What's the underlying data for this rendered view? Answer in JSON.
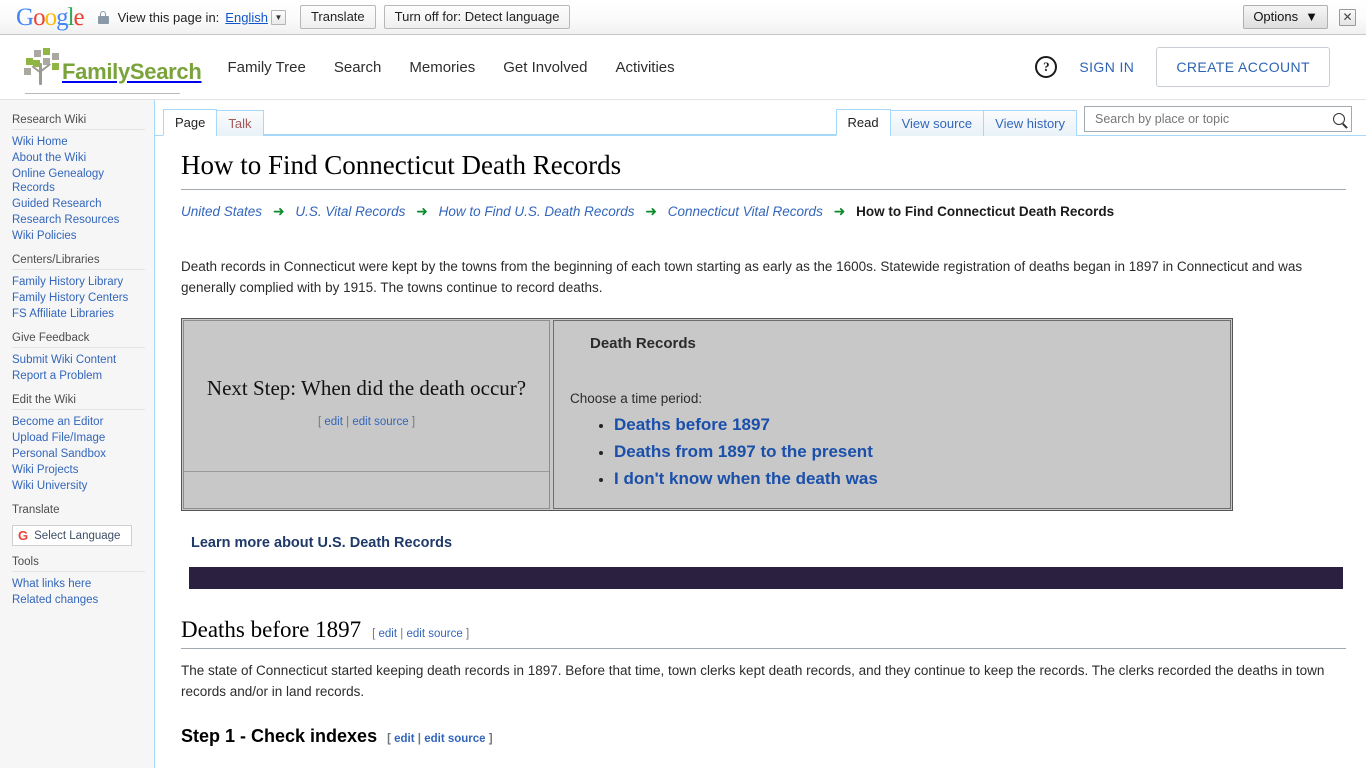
{
  "translate_bar": {
    "logo_letters": [
      "G",
      "o",
      "o",
      "g",
      "l",
      "e"
    ],
    "view_label": "View this page in:",
    "language": "English",
    "translate_button": "Translate",
    "turnoff_button": "Turn off for: Detect language",
    "options_button": "Options",
    "options_caret": "▼",
    "close_glyph": "✕"
  },
  "header": {
    "brand": "FamilySearch",
    "nav": [
      {
        "label": "Family Tree"
      },
      {
        "label": "Search"
      },
      {
        "label": "Memories"
      },
      {
        "label": "Get Involved"
      },
      {
        "label": "Activities"
      }
    ],
    "help_glyph": "?",
    "sign_in": "SIGN IN",
    "create_account": "CREATE ACCOUNT"
  },
  "sidebar": {
    "groups": [
      {
        "title": "Research Wiki",
        "items": [
          {
            "label": "Wiki Home"
          },
          {
            "label": "About the Wiki"
          },
          {
            "label": "Online Genealogy Records"
          },
          {
            "label": "Guided Research"
          },
          {
            "label": "Research Resources"
          },
          {
            "label": "Wiki Policies"
          }
        ]
      },
      {
        "title": "Centers/Libraries",
        "items": [
          {
            "label": "Family History Library"
          },
          {
            "label": "Family History Centers"
          },
          {
            "label": "FS Affiliate Libraries"
          }
        ]
      },
      {
        "title": "Give Feedback",
        "items": [
          {
            "label": "Submit Wiki Content"
          },
          {
            "label": "Report a Problem"
          }
        ]
      },
      {
        "title": "Edit the Wiki",
        "items": [
          {
            "label": "Become an Editor"
          },
          {
            "label": "Upload File/Image"
          },
          {
            "label": "Personal Sandbox"
          },
          {
            "label": "Wiki Projects"
          },
          {
            "label": "Wiki University"
          }
        ]
      }
    ],
    "translate_title": "Translate",
    "select_language": "Select Language",
    "google_g": "G",
    "tools_title": "Tools",
    "tools_items": [
      {
        "label": "What links here"
      },
      {
        "label": "Related changes"
      }
    ]
  },
  "tabs": {
    "left": [
      {
        "label": "Page",
        "selected": true
      },
      {
        "label": "Talk",
        "selected": false
      }
    ],
    "right": [
      {
        "label": "Read",
        "selected": true
      },
      {
        "label": "View source",
        "selected": false
      },
      {
        "label": "View history",
        "selected": false
      }
    ]
  },
  "search": {
    "placeholder": "Search by place or topic",
    "value": "",
    "icon": "search-icon"
  },
  "main": {
    "title": "How to Find Connecticut Death Records",
    "breadcrumb": {
      "arrow": "➜",
      "items": [
        {
          "label": "United States",
          "current": false
        },
        {
          "label": "U.S. Vital Records",
          "current": false
        },
        {
          "label": "How to Find U.S. Death Records",
          "current": false
        },
        {
          "label": "Connecticut Vital Records",
          "current": false
        },
        {
          "label": "How to Find Connecticut Death Records",
          "current": true
        }
      ]
    },
    "intro": "Death records in Connecticut were kept by the towns from the beginning of each town starting as early as the 1600s. Statewide registration of deaths began in 1897 in Connecticut and was generally complied with by 1915. The towns continue to record deaths.",
    "panel": {
      "next_step_heading": "Next Step: When did the death occur?",
      "edit_open": "[",
      "edit_label": "edit",
      "edit_sep": "|",
      "edit_source_label": "edit source",
      "edit_close": "]",
      "records_heading": "Death Records",
      "choose_label": "Choose a time period:",
      "options": [
        {
          "label": "Deaths before 1897"
        },
        {
          "label": "Deaths from 1897 to the present"
        },
        {
          "label": "I don't know when the death was"
        }
      ]
    },
    "learn_more": "Learn more about U.S. Death Records",
    "section1": {
      "heading": "Deaths before 1897",
      "paragraph": "The state of Connecticut started keeping death records in 1897. Before that time, town clerks kept death records, and they continue to keep the records. The clerks recorded the deaths in town records and/or in land records.",
      "step_heading": "Step 1 - Check indexes"
    }
  },
  "colors": {
    "brand_green": "#7aa43b",
    "link_blue": "#3366bb",
    "purple_bar": "#2c2040",
    "panel_gray": "#c8c8c8",
    "tab_border": "#a7d7f9"
  }
}
